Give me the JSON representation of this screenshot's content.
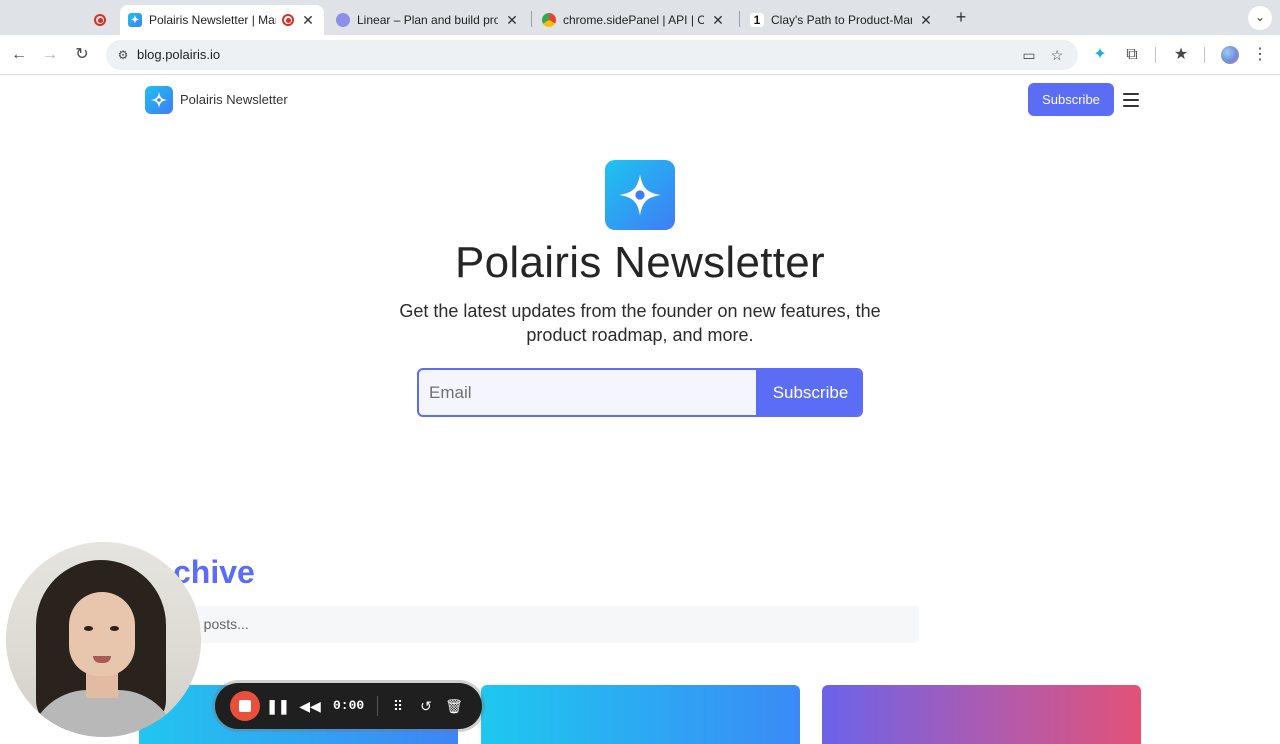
{
  "browser": {
    "tabs": [
      {
        "title": "",
        "recording": true,
        "active": false,
        "favicon": "recording-icon"
      },
      {
        "title": "Polairis Newsletter | Mana",
        "recording": true,
        "active": true,
        "favicon": "polairis-favicon"
      },
      {
        "title": "Linear – Plan and build produ",
        "active": false,
        "favicon": "linear-favicon"
      },
      {
        "title": "chrome.sidePanel  |  API  |  Ch",
        "active": false,
        "favicon": "chrome-favicon"
      },
      {
        "title": "Clay's Path to Product-Marke",
        "active": false,
        "favicon": "notion-favicon"
      }
    ],
    "address": "blog.polairis.io"
  },
  "site": {
    "name": "Polairis Newsletter",
    "nav_subscribe": "Subscribe"
  },
  "hero": {
    "title": "Polairis Newsletter",
    "subtitle": "Get the latest updates from the founder on new features, the product roadmap, and more.",
    "email_placeholder": "Email",
    "subscribe_label": "Subscribe"
  },
  "archive": {
    "title": "chive",
    "search_placeholder": "ch posts..."
  },
  "recorder": {
    "time": "0:00"
  },
  "colors": {
    "accent": "#5b6cf5",
    "logo_gradient_start": "#1dc4ef",
    "logo_gradient_end": "#3f7df6"
  }
}
